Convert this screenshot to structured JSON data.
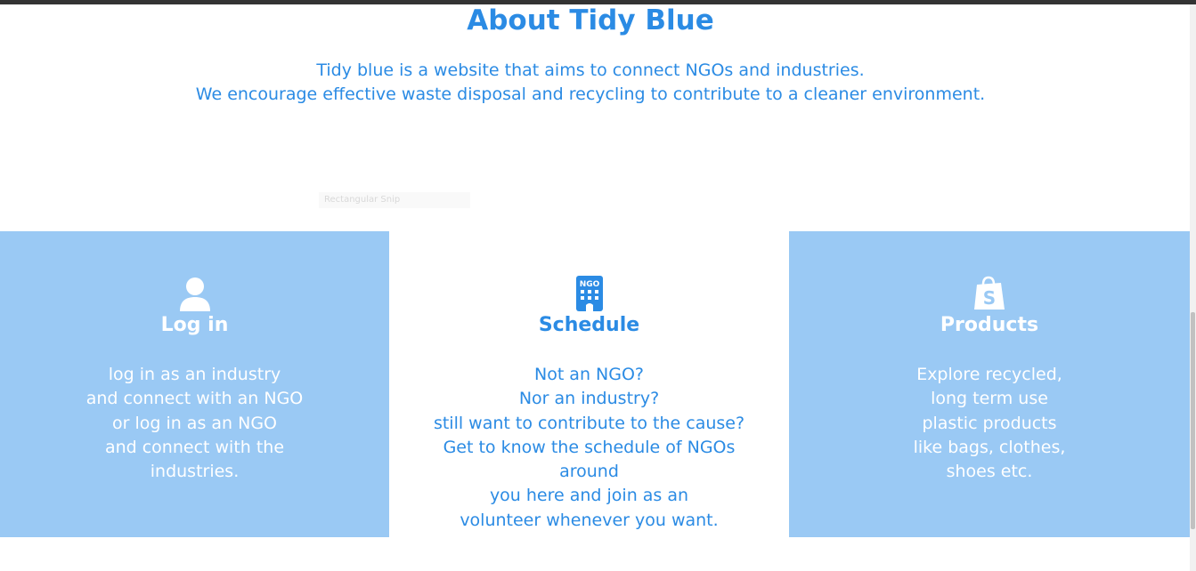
{
  "about": {
    "title": "About Tidy Blue",
    "lines": [
      "Tidy blue is a website that aims to connect NGOs and industries.",
      "We encourage effective waste disposal and recycling to contribute to a cleaner environment."
    ]
  },
  "snip_overlay": {
    "label": "Rectangular Snip"
  },
  "cards": {
    "login": {
      "icon": "user-icon",
      "title": "Log in",
      "lines": [
        "log in as an industry",
        "and connect with an NGO",
        "or log in as an NGO",
        "and connect with the",
        "industries."
      ]
    },
    "schedule": {
      "icon": "ngo-building-icon",
      "icon_text": "NGO",
      "title": "Schedule",
      "lines": [
        "Not an NGO?",
        "Nor an industry?",
        "still want to contribute to the cause?",
        "Get to know the schedule of NGOs",
        "around",
        "you here and join as an",
        "volunteer whenever you want."
      ]
    },
    "products": {
      "icon": "shopify-bag-icon",
      "title": "Products",
      "lines": [
        "Explore recycled,",
        "long term use",
        "plastic products",
        "like bags, clothes,",
        "shoes etc."
      ]
    }
  },
  "colors": {
    "accent": "#2b8be4",
    "card_blue": "#9ac9f4",
    "white": "#ffffff"
  }
}
